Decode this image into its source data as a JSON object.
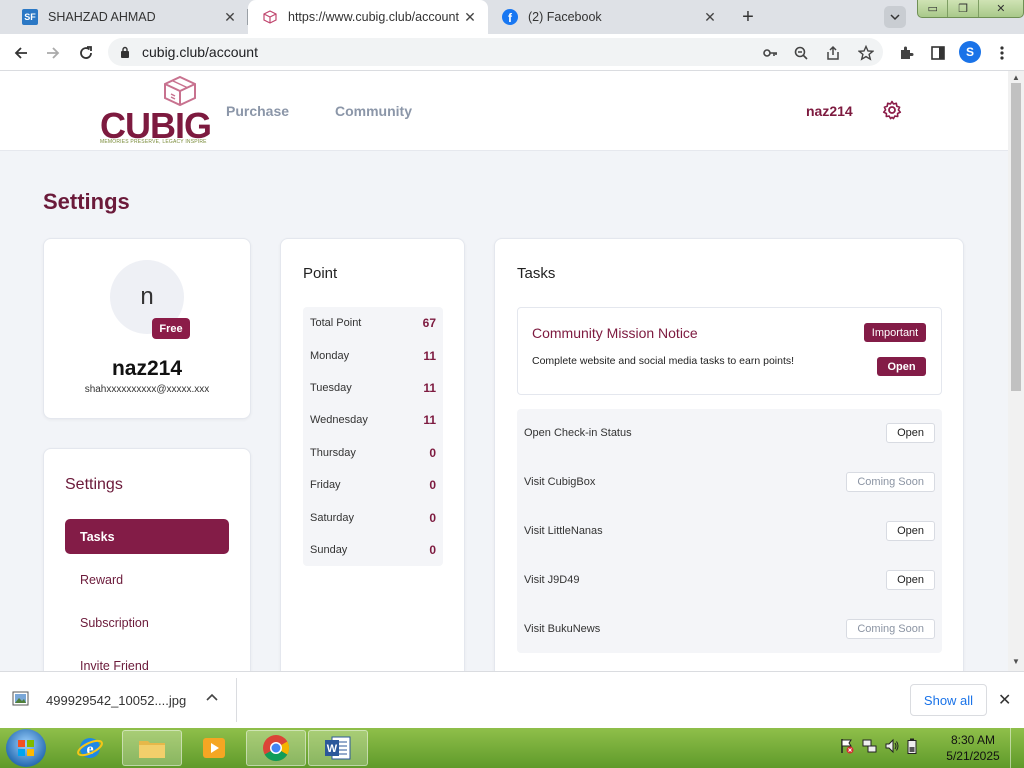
{
  "browser": {
    "tabs": [
      {
        "title": "SHAHZAD AHMAD",
        "favicon": "sf-icon",
        "active": false
      },
      {
        "title": "https://www.cubig.club/account",
        "favicon": "cubig-icon",
        "active": true
      },
      {
        "title": "(2) Facebook",
        "favicon": "facebook-icon",
        "active": false
      }
    ],
    "favicon_sf_text": "SF",
    "url": "cubig.club/account",
    "profile_initial": "S"
  },
  "site": {
    "logo_text": "CUBIG",
    "logo_tagline": "MEMORIES PRESERVE, LEGACY INSPIRE",
    "nav": [
      "Purchase",
      "Community"
    ],
    "username": "naz214"
  },
  "page": {
    "title": "Settings"
  },
  "profile": {
    "avatar_initial": "n",
    "badge": "Free",
    "name": "naz214",
    "email": "shahxxxxxxxxxx@xxxxx.xxx"
  },
  "settings_nav": {
    "title": "Settings",
    "items": [
      "Tasks",
      "Reward",
      "Subscription",
      "Invite Friend"
    ],
    "active": "Tasks"
  },
  "points": {
    "title": "Point",
    "rows": [
      {
        "label": "Total Point",
        "value": "67"
      },
      {
        "label": "Monday",
        "value": "11"
      },
      {
        "label": "Tuesday",
        "value": "11"
      },
      {
        "label": "Wednesday",
        "value": "11"
      },
      {
        "label": "Thursday",
        "value": "0"
      },
      {
        "label": "Friday",
        "value": "0"
      },
      {
        "label": "Saturday",
        "value": "0"
      },
      {
        "label": "Sunday",
        "value": "0"
      }
    ]
  },
  "tasks": {
    "title": "Tasks",
    "notice": {
      "title": "Community Mission Notice",
      "badge": "Important",
      "text": "Complete website and social media tasks to earn points!",
      "button": "Open"
    },
    "items": [
      {
        "label": "Open Check-in Status",
        "button": "Open",
        "available": true
      },
      {
        "label": "Visit CubigBox",
        "button": "Coming Soon",
        "available": false
      },
      {
        "label": "Visit LittleNanas",
        "button": "Open",
        "available": true
      },
      {
        "label": "Visit J9D49",
        "button": "Open",
        "available": true
      },
      {
        "label": "Visit BukuNews",
        "button": "Coming Soon",
        "available": false
      }
    ]
  },
  "downloads": {
    "file_name": "499929542_10052....jpg",
    "show_all": "Show all"
  },
  "taskbar": {
    "apps": [
      "start-button",
      "internet-explorer",
      "file-explorer",
      "media-player",
      "chrome",
      "word"
    ],
    "time": "8:30 AM",
    "date": "5/21/2025"
  },
  "colors": {
    "brand": "#831c47",
    "brand_text": "#7d1a3f",
    "page_bg": "#f2f4f8",
    "nav_muted": "#8b96a8"
  }
}
